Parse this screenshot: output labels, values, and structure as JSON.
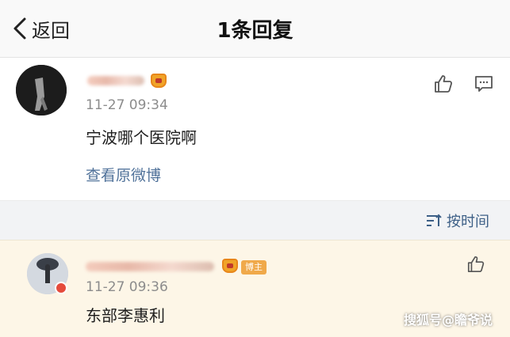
{
  "nav": {
    "back_label": "返回",
    "title": "1条回复",
    "back_icon": "chevron-left-icon"
  },
  "post": {
    "time": "11-27 09:34",
    "text": "宁波哪个医院啊",
    "view_original": "查看原微博",
    "icons": [
      "thumbs-up-icon",
      "comment-icon"
    ]
  },
  "sort": {
    "label": "按时间",
    "icon": "sort-icon"
  },
  "reply": {
    "badge": "博主",
    "time": "11-27 09:36",
    "text": "东部李惠利",
    "icons": [
      "thumbs-up-icon"
    ]
  },
  "watermark": "搜狐号@瞻爷说",
  "colors": {
    "link": "#50729a",
    "reply_bg": "#fdf6e7",
    "badge": "#f0a94a"
  }
}
